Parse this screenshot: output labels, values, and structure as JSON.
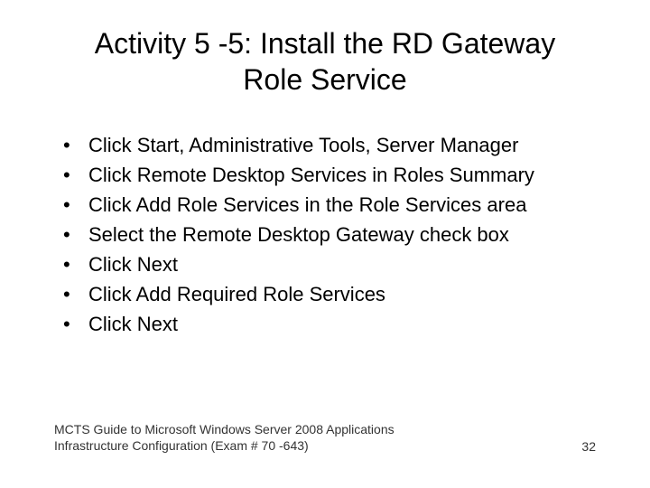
{
  "title": "Activity 5 -5: Install the RD Gateway Role Service",
  "bullets": [
    "Click Start, Administrative Tools, Server Manager",
    "Click Remote Desktop Services in Roles Summary",
    "Click Add Role Services in the Role Services area",
    "Select the Remote Desktop Gateway check box",
    "Click Next",
    "Click Add Required Role Services",
    "Click Next"
  ],
  "footer": {
    "text": "MCTS Guide to Microsoft Windows Server 2008 Applications Infrastructure Configuration (Exam # 70 -643)",
    "page": "32"
  }
}
